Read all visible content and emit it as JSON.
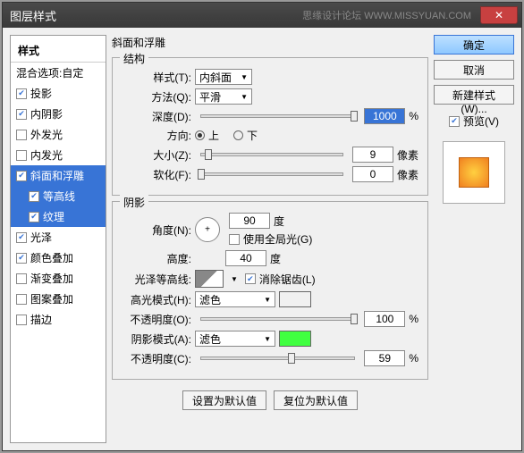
{
  "window": {
    "title": "图层样式",
    "watermark": "思缘设计论坛  WWW.MISSYUAN.COM"
  },
  "left": {
    "header": "样式",
    "blending": "混合选项:自定",
    "items": [
      {
        "label": "投影",
        "checked": true
      },
      {
        "label": "内阴影",
        "checked": true
      },
      {
        "label": "外发光",
        "checked": false
      },
      {
        "label": "内发光",
        "checked": false
      },
      {
        "label": "斜面和浮雕",
        "checked": true,
        "selected": true
      },
      {
        "label": "等高线",
        "checked": true,
        "sub": true,
        "selected": true
      },
      {
        "label": "纹理",
        "checked": true,
        "sub": true,
        "selected": true
      },
      {
        "label": "光泽",
        "checked": true
      },
      {
        "label": "颜色叠加",
        "checked": true
      },
      {
        "label": "渐变叠加",
        "checked": false
      },
      {
        "label": "图案叠加",
        "checked": false
      },
      {
        "label": "描边",
        "checked": false
      }
    ]
  },
  "center": {
    "title": "斜面和浮雕",
    "structure": {
      "legend": "结构",
      "style_label": "样式(T):",
      "style_value": "内斜面",
      "method_label": "方法(Q):",
      "method_value": "平滑",
      "depth_label": "深度(D):",
      "depth_value": "1000",
      "depth_unit": "%",
      "direction_label": "方向:",
      "up": "上",
      "down": "下",
      "size_label": "大小(Z):",
      "size_value": "9",
      "size_unit": "像素",
      "soften_label": "软化(F):",
      "soften_value": "0",
      "soften_unit": "像素"
    },
    "shading": {
      "legend": "阴影",
      "angle_label": "角度(N):",
      "angle_value": "90",
      "angle_unit": "度",
      "global_label": "使用全局光(G)",
      "altitude_label": "高度:",
      "altitude_value": "40",
      "altitude_unit": "度",
      "contour_label": "光泽等高线:",
      "antialias_label": "消除锯齿(L)",
      "highlight_mode_label": "高光模式(H):",
      "highlight_mode_value": "滤色",
      "highlight_color": "#ffffff",
      "highlight_opacity_label": "不透明度(O):",
      "highlight_opacity_value": "100",
      "opacity_unit": "%",
      "shadow_mode_label": "阴影模式(A):",
      "shadow_mode_value": "滤色",
      "shadow_color": "#40ff40",
      "shadow_opacity_label": "不透明度(C):",
      "shadow_opacity_value": "59"
    },
    "defaults": {
      "set": "设置为默认值",
      "reset": "复位为默认值"
    }
  },
  "right": {
    "ok": "确定",
    "cancel": "取消",
    "new_style": "新建样式(W)...",
    "preview_label": "预览(V)"
  }
}
